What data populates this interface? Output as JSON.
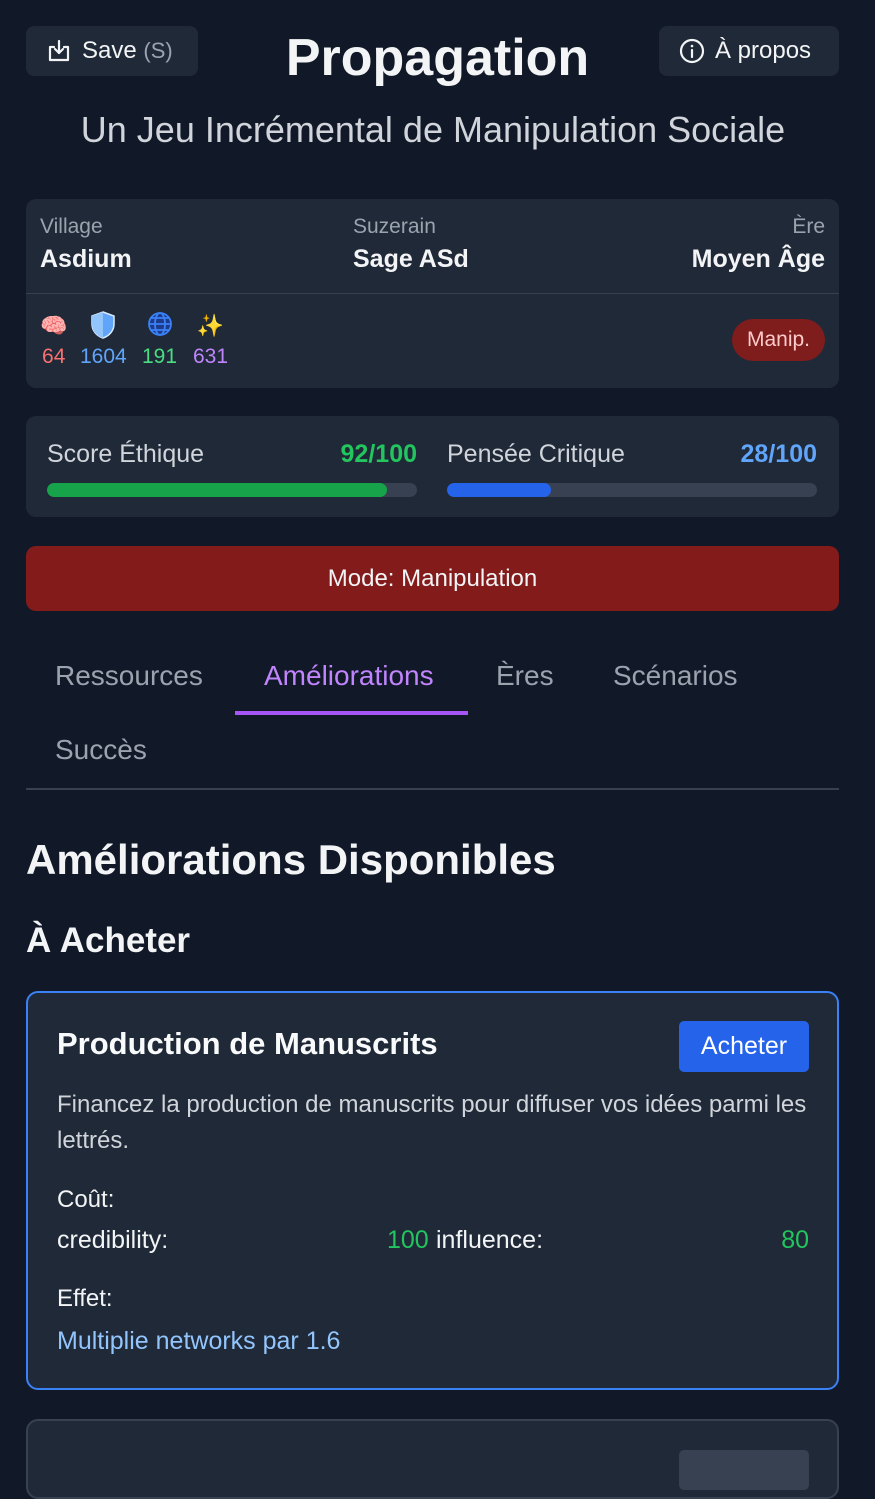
{
  "header": {
    "save_label": "Save",
    "save_shortcut": "(S)",
    "title": "Propagation",
    "about_label": "À propos",
    "subtitle": "Un Jeu Incrémental de Manipulation Sociale"
  },
  "info": {
    "village_label": "Village",
    "village_value": "Asdium",
    "suzerain_label": "Suzerain",
    "suzerain_value": "Sage ASd",
    "era_label": "Ère",
    "era_value": "Moyen Âge",
    "resources": [
      {
        "icon": "🧠",
        "icon_name": "brain-icon",
        "value": "64",
        "color": "#f87171"
      },
      {
        "icon": "🛡",
        "icon_name": "shield-icon",
        "value": "1604",
        "color": "#60a5fa"
      },
      {
        "icon": "🌐",
        "icon_name": "globe-icon",
        "value": "191",
        "color": "#4ade80"
      },
      {
        "icon": "✨",
        "icon_name": "sparkles-icon",
        "value": "631",
        "color": "#c084fc"
      }
    ],
    "mode_badge": "Manip."
  },
  "scores": {
    "ethics_label": "Score Éthique",
    "ethics_value": "92/100",
    "ethics_fraction": 0.92,
    "ethics_color": "#16a34a",
    "critical_label": "Pensée Critique",
    "critical_value": "28/100",
    "critical_fraction": 0.28,
    "critical_color": "#2563eb"
  },
  "mode_button": "Mode: Manipulation",
  "tabs": [
    {
      "label": "Ressources",
      "active": false
    },
    {
      "label": "Améliorations",
      "active": true
    },
    {
      "label": "Ères",
      "active": false
    },
    {
      "label": "Scénarios",
      "active": false
    },
    {
      "label": "Succès",
      "active": false
    }
  ],
  "section": {
    "title": "Améliorations Disponibles",
    "subtitle": "À Acheter"
  },
  "upgrade": {
    "title": "Production de Manuscrits",
    "buy_label": "Acheter",
    "description": "Financez la production de manuscrits pour diffuser vos idées parmi les lettrés.",
    "cost_label": "Coût:",
    "costs": [
      {
        "name": "credibility:",
        "amount": "100"
      },
      {
        "name": "influence:",
        "amount": "80"
      }
    ],
    "effect_label": "Effet:",
    "effect_text": "Multiplie networks par 1.6"
  },
  "colors": {
    "background": "#111827",
    "card": "#1f2937",
    "accent_tab": "#a855f7",
    "mode_red": "#831b1b",
    "buy_blue": "#2563eb"
  }
}
